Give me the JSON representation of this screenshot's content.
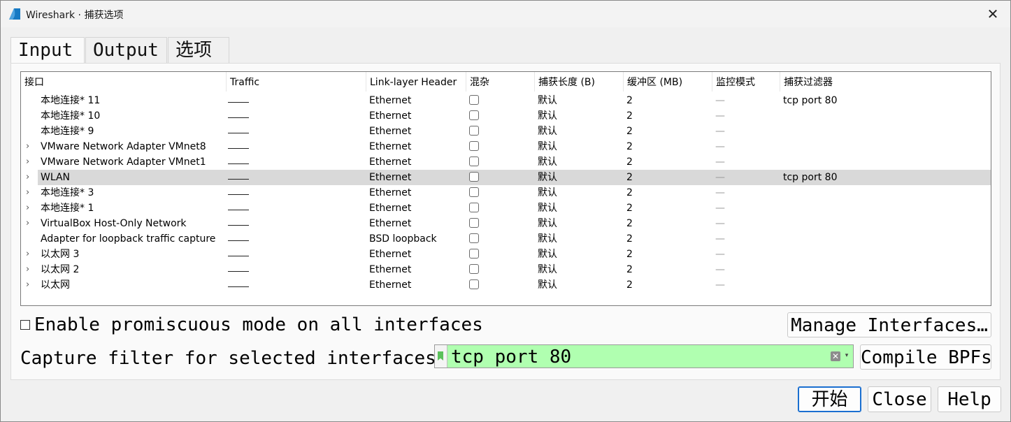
{
  "window": {
    "title": "Wireshark · 捕获选项",
    "close_glyph": "✕"
  },
  "tabs": [
    {
      "label": "Input",
      "active": true
    },
    {
      "label": "Output",
      "active": false
    },
    {
      "label": "选项",
      "active": false
    }
  ],
  "table": {
    "headers": [
      "接口",
      "Traffic",
      "Link-layer Header",
      "混杂",
      "捕获长度 (B)",
      "缓冲区 (MB)",
      "监控模式",
      "捕获过滤器"
    ],
    "rows": [
      {
        "expandable": false,
        "name": "本地连接* 11",
        "link": "Ethernet",
        "caplen": "默认",
        "buffer": "2",
        "filter": "tcp port 80",
        "selected": false
      },
      {
        "expandable": false,
        "name": "本地连接* 10",
        "link": "Ethernet",
        "caplen": "默认",
        "buffer": "2",
        "filter": "",
        "selected": false
      },
      {
        "expandable": false,
        "name": "本地连接* 9",
        "link": "Ethernet",
        "caplen": "默认",
        "buffer": "2",
        "filter": "",
        "selected": false
      },
      {
        "expandable": true,
        "name": "VMware Network Adapter VMnet8",
        "link": "Ethernet",
        "caplen": "默认",
        "buffer": "2",
        "filter": "",
        "selected": false
      },
      {
        "expandable": true,
        "name": "VMware Network Adapter VMnet1",
        "link": "Ethernet",
        "caplen": "默认",
        "buffer": "2",
        "filter": "",
        "selected": false
      },
      {
        "expandable": true,
        "name": "WLAN",
        "link": "Ethernet",
        "caplen": "默认",
        "buffer": "2",
        "filter": "tcp port 80",
        "selected": true
      },
      {
        "expandable": true,
        "name": "本地连接* 3",
        "link": "Ethernet",
        "caplen": "默认",
        "buffer": "2",
        "filter": "",
        "selected": false
      },
      {
        "expandable": true,
        "name": "本地连接* 1",
        "link": "Ethernet",
        "caplen": "默认",
        "buffer": "2",
        "filter": "",
        "selected": false
      },
      {
        "expandable": true,
        "name": "VirtualBox Host-Only Network",
        "link": "Ethernet",
        "caplen": "默认",
        "buffer": "2",
        "filter": "",
        "selected": false
      },
      {
        "expandable": false,
        "name": "Adapter for loopback traffic capture",
        "link": "BSD loopback",
        "caplen": "默认",
        "buffer": "2",
        "filter": "",
        "selected": false
      },
      {
        "expandable": true,
        "name": "以太网 3",
        "link": "Ethernet",
        "caplen": "默认",
        "buffer": "2",
        "filter": "",
        "selected": false
      },
      {
        "expandable": true,
        "name": "以太网 2",
        "link": "Ethernet",
        "caplen": "默认",
        "buffer": "2",
        "filter": "",
        "selected": false
      },
      {
        "expandable": true,
        "name": "以太网",
        "link": "Ethernet",
        "caplen": "默认",
        "buffer": "2",
        "filter": "",
        "selected": false
      }
    ],
    "monitor_dash": "—",
    "expander_glyph": "›"
  },
  "promiscuous": {
    "label": "Enable promiscuous mode on all interfaces",
    "checked": false
  },
  "manage_button": "Manage Interfaces…",
  "capture_filter": {
    "label": "Capture filter for selected interfaces:",
    "value": "tcp port 80",
    "clear_glyph": "✕",
    "dropdown_glyph": "▾",
    "valid_color": "#b0ffb0"
  },
  "compile_button": "Compile BPFs",
  "buttons": {
    "start": "开始",
    "close": "Close",
    "help": "Help"
  }
}
